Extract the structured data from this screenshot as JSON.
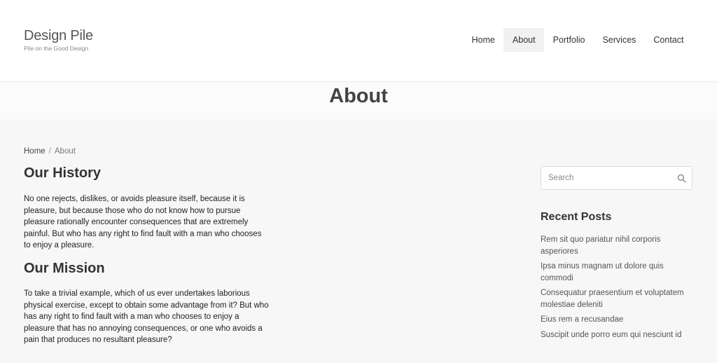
{
  "logo": {
    "title": "Design Pile",
    "tagline": "Pile on the Good Design"
  },
  "nav": {
    "items": [
      {
        "label": "Home"
      },
      {
        "label": "About"
      },
      {
        "label": "Portfolio"
      },
      {
        "label": "Services"
      },
      {
        "label": "Contact"
      }
    ],
    "active": "About"
  },
  "page_title": "About",
  "breadcrumb": {
    "home": "Home",
    "separator": "/",
    "current": "About"
  },
  "content": {
    "history_heading": "Our History",
    "history_text": "No one rejects, dislikes, or avoids pleasure itself, because it is pleasure, but because those who do not know how to pursue pleasure rationally encounter consequences that are extremely painful. But who has any right to find fault with a man who chooses to enjoy a pleasure.",
    "mission_heading": "Our Mission",
    "mission_text": "To take a trivial example, which of us ever undertakes laborious physical exercise, except to obtain some advantage from it? But who has any right to find fault with a man who chooses to enjoy a pleasure that has no annoying consequences, or one who avoids a pain that produces no resultant pleasure?"
  },
  "sidebar": {
    "search_placeholder": "Search",
    "recent_title": "Recent Posts",
    "recent_posts": [
      "Rem sit quo pariatur nihil corporis asperiores",
      "Ipsa minus magnam ut dolore quis commodi",
      "Consequatur praesentium et voluptatem molestiae deleniti",
      "Eius rem a recusandae",
      "Suscipit unde porro eum qui nesciunt id"
    ]
  },
  "colors": {
    "page_background": "#f7f7f7",
    "header_background": "#ffffff",
    "active_nav_background": "#f1f1f1"
  },
  "icons": {
    "search": "search-icon"
  }
}
